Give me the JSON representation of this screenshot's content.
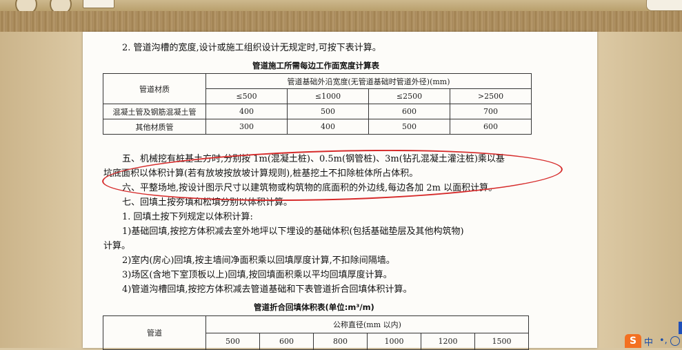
{
  "document": {
    "intro_line": "2. 管道沟槽的宽度,设计或施工组织设计无规定时,可按下表计算。",
    "table1": {
      "caption": "管道施工所需每边工作面宽度计算表",
      "corner_header": "管道材质",
      "group_header": "管道基础外沿宽度(无管道基础时管道外径)(mm)",
      "columns": [
        "≤500",
        "≤1000",
        "≤2500",
        ">2500"
      ],
      "rows": [
        {
          "material": "混凝土管及钢筋混凝土管",
          "values": [
            "400",
            "500",
            "600",
            "700"
          ]
        },
        {
          "material": "其他材质管",
          "values": [
            "300",
            "400",
            "500",
            "600"
          ]
        }
      ]
    },
    "para5_line1": "五、机械挖有桩基土方时,分别按 1m(混凝土桩)、0.5m(钢管桩)、3m(钻孔混凝土灌注桩)乘以基",
    "para5_line2": "坑底面积以体积计算(若有放坡按放坡计算规则),桩基挖土不扣除桩体所占体积。",
    "para6": "六、平整场地,按设计图示尺寸以建筑物或构筑物的底面积的外边线,每边各加 2m 以面积计算。",
    "para7": "七、回填土按夯填和松填分别以体积计算。",
    "item1": "1. 回填土按下列规定以体积计算:",
    "sub1_line1": "1)基础回填,按挖方体积减去室外地坪以下埋设的基础体积(包括基础垫层及其他构筑物)",
    "sub1_line2": "计算。",
    "sub2": "2)室内(房心)回填,按主墙间净面积乘以回填厚度计算,不扣除间隔墙。",
    "sub3": "3)场区(含地下室顶板以上)回填,按回填面积乘以平均回填厚度计算。",
    "sub4": "4)管道沟槽回填,按挖方体积减去管道基础和下表管道折合回填体积计算。",
    "table2": {
      "caption": "管道折合回填体积表(单位:m³/m)",
      "corner_header": "管道",
      "group_header": "公称直径(mm 以内)",
      "columns": [
        "500",
        "600",
        "800",
        "1000",
        "1200",
        "1500"
      ]
    }
  },
  "tray": {
    "ime_logo": "S",
    "ime_lang": "中",
    "ime_punct": "•,"
  },
  "colors": {
    "annotation": "#d62a2a",
    "ime": "#f37021"
  }
}
